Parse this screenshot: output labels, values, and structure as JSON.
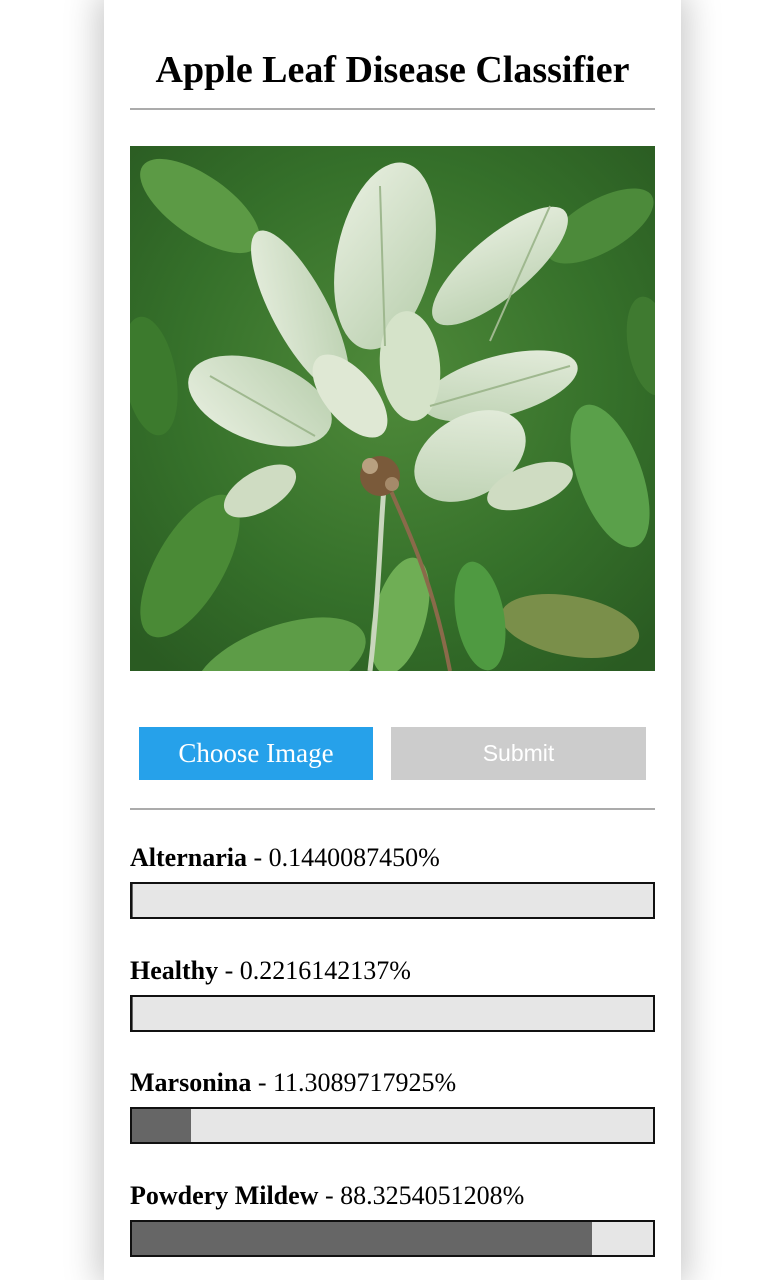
{
  "header": {
    "title": "Apple Leaf Disease Classifier"
  },
  "image": {
    "subject": "apple-leaf-photo"
  },
  "controls": {
    "choose_label": "Choose Image",
    "submit_label": "Submit"
  },
  "results": [
    {
      "name": "Alternaria",
      "separator": " - ",
      "value_text": "0.1440087450%",
      "percent": 0.144008745
    },
    {
      "name": "Healthy",
      "separator": " - ",
      "value_text": "0.2216142137%",
      "percent": 0.2216142137
    },
    {
      "name": "Marsonina",
      "separator": " - ",
      "value_text": "11.3089717925%",
      "percent": 11.3089717925
    },
    {
      "name": "Powdery Mildew",
      "separator": " - ",
      "value_text": "88.3254051208%",
      "percent": 88.3254051208
    }
  ],
  "colors": {
    "accent": "#26a1ea",
    "disabled": "#cccccc",
    "bar_fill": "#666666",
    "bar_track": "#e6e6e6"
  }
}
